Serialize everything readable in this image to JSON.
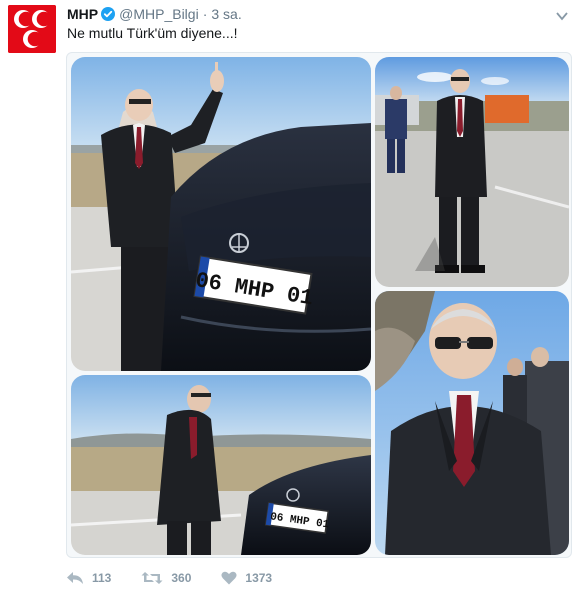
{
  "account": {
    "name": "MHP",
    "handle": "@MHP_Bilgi",
    "time": "3 sa.",
    "avatar_icon": "mhp-crescents-logo",
    "avatar_color": "#e30a17",
    "verified_icon": "verified-badge-icon"
  },
  "tweet": {
    "text": "Ne mutlu Türk'üm diyene...!"
  },
  "media": {
    "photos": [
      {
        "plate": "06 MHP 01"
      },
      {
        "plate": ""
      },
      {
        "plate": "06 MHP 01"
      },
      {
        "plate": ""
      }
    ]
  },
  "actions": {
    "reply_icon": "reply-icon",
    "reply_count": "113",
    "retweet_icon": "retweet-icon",
    "retweet_count": "360",
    "like_icon": "heart-icon",
    "like_count": "1373"
  },
  "colors": {
    "text": "#14171a",
    "muted": "#657786",
    "verified": "#1da1f2",
    "action": "#8899a6"
  }
}
